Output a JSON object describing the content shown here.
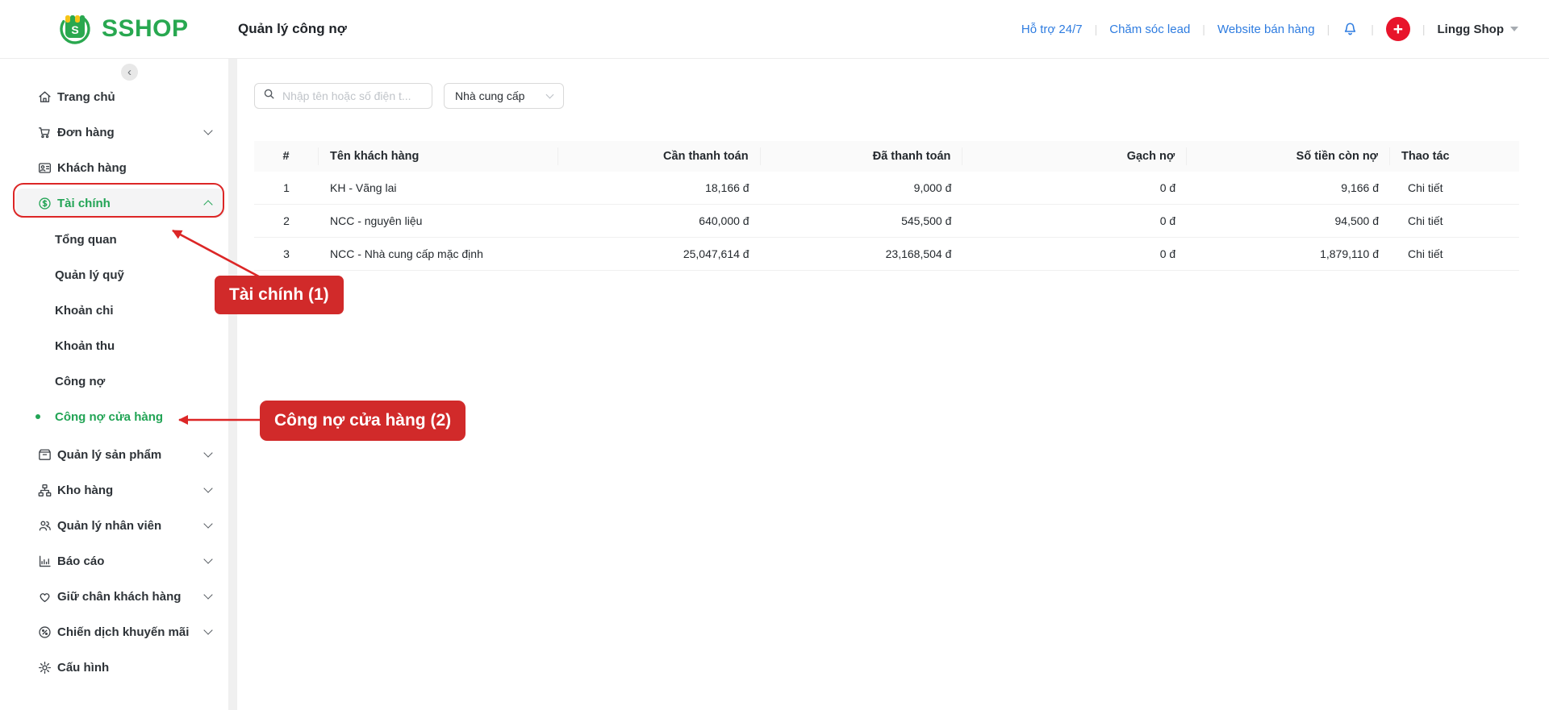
{
  "brand": {
    "name": "SSHOP",
    "logo_icon": "sshop-logo-icon"
  },
  "topbar": {
    "title": "Quản lý công nợ",
    "links": [
      {
        "id": "ho-tro",
        "label": "Hỗ trợ 24/7"
      },
      {
        "id": "cham-soc-lead",
        "label": "Chăm sóc lead"
      },
      {
        "id": "website-ban-hang",
        "label": "Website bán hàng"
      }
    ],
    "icons": {
      "notification": "bell-icon",
      "add": "plus-icon",
      "account_caret": "chevron-down-icon"
    },
    "add_glyph": "+",
    "account": {
      "name": "Lingg Shop"
    }
  },
  "sidebar": {
    "collapse_glyph": "‹",
    "items": [
      {
        "id": "trang-chu",
        "label": "Trang chủ",
        "icon": "home-icon",
        "chevron": null
      },
      {
        "id": "don-hang",
        "label": "Đơn hàng",
        "icon": "cart-icon",
        "chevron": "down"
      },
      {
        "id": "khach-hang",
        "label": "Khách hàng",
        "icon": "customers-icon",
        "chevron": null
      },
      {
        "id": "tai-chinh",
        "label": "Tài chính",
        "icon": "finance-icon",
        "chevron": "up",
        "active": true,
        "submenu": [
          {
            "id": "tong-quan",
            "label": "Tổng quan"
          },
          {
            "id": "quan-ly-quy",
            "label": "Quản lý quỹ"
          },
          {
            "id": "khoan-chi",
            "label": "Khoản chi"
          },
          {
            "id": "khoan-thu",
            "label": "Khoản thu"
          },
          {
            "id": "cong-no",
            "label": "Công nợ"
          },
          {
            "id": "cong-no-cua-hang",
            "label": "Công nợ cửa hàng",
            "selected": true
          }
        ]
      },
      {
        "id": "quan-ly-san-pham",
        "label": "Quản lý sản phẩm",
        "icon": "products-icon",
        "chevron": "down"
      },
      {
        "id": "kho-hang",
        "label": "Kho hàng",
        "icon": "warehouse-icon",
        "chevron": "down"
      },
      {
        "id": "quan-ly-nhan-vien",
        "label": "Quản lý nhân viên",
        "icon": "staff-icon",
        "chevron": "down"
      },
      {
        "id": "bao-cao",
        "label": "Báo cáo",
        "icon": "report-icon",
        "chevron": "down"
      },
      {
        "id": "giu-chan-khach-hang",
        "label": "Giữ chân khách hàng",
        "icon": "retention-icon",
        "chevron": "down"
      },
      {
        "id": "chien-dich-khuyen-mai",
        "label": "Chiến dịch khuyến mãi",
        "icon": "promotion-icon",
        "chevron": "down"
      },
      {
        "id": "cau-hinh",
        "label": "Cấu hình",
        "icon": "settings-icon",
        "chevron": null
      }
    ]
  },
  "filters": {
    "search_placeholder": "Nhập tên hoặc số điện t...",
    "search_icon": "search-icon",
    "supplier_select": "Nhà cung cấp"
  },
  "table": {
    "columns": [
      "#",
      "Tên khách hàng",
      "Cần thanh toán",
      "Đã thanh toán",
      "Gạch nợ",
      "Số tiền còn nợ",
      "Thao tác"
    ],
    "rows": [
      [
        "1",
        "KH - Vãng lai",
        "18,166 đ",
        "9,000 đ",
        "0 đ",
        "9,166 đ",
        "Chi tiết"
      ],
      [
        "2",
        "NCC - nguyên liệu",
        "640,000 đ",
        "545,500 đ",
        "0 đ",
        "94,500 đ",
        "Chi tiết"
      ],
      [
        "3",
        "NCC - Nhà cung cấp mặc định",
        "25,047,614 đ",
        "23,168,504 đ",
        "0 đ",
        "1,879,110 đ",
        "Chi tiết"
      ]
    ]
  },
  "annotations": {
    "callout_1": "Tài chính (1)",
    "callout_2": "Công nợ cửa hàng (2)"
  },
  "colors": {
    "brand_green": "#22a455",
    "link_blue": "#2e7ce0",
    "annotation_red": "#dc2626",
    "callout_red": "#d12a2a",
    "plus_red": "#e8142b"
  }
}
